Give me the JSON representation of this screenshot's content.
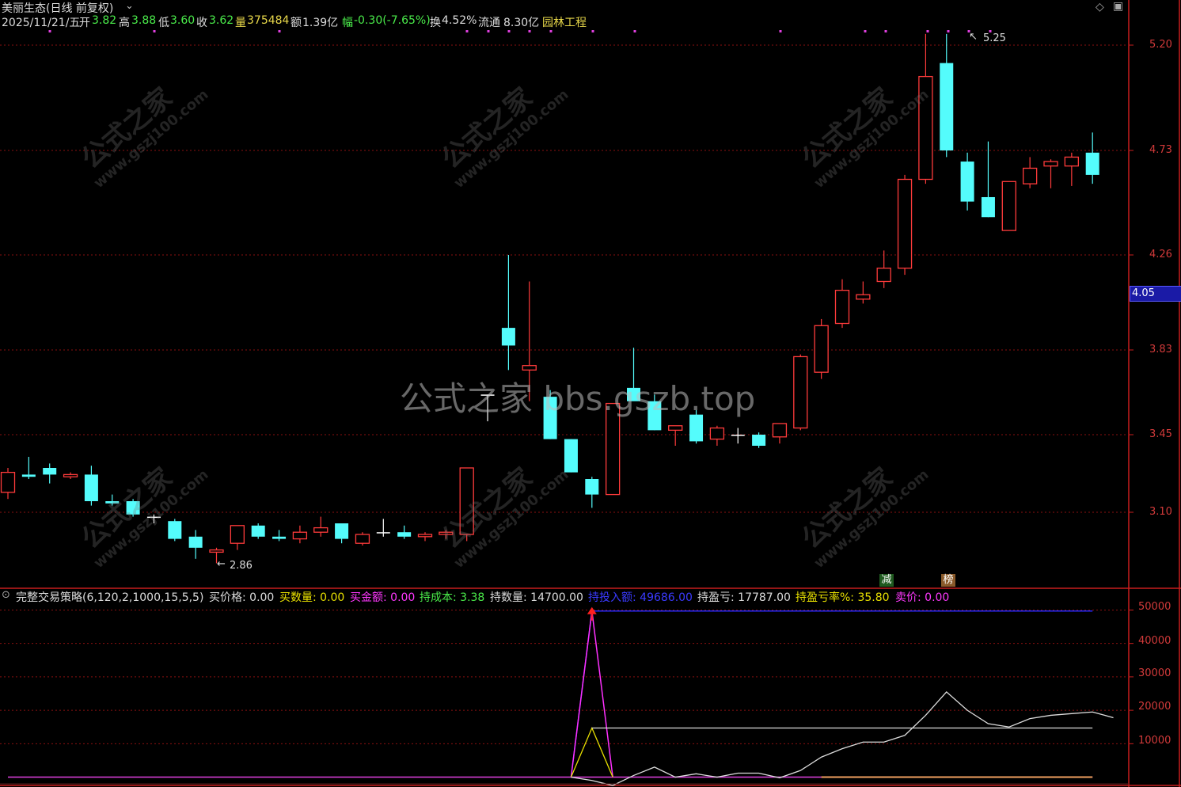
{
  "header": {
    "stock_title": "美丽生态(日线 前复权)",
    "date": "2025/11/21/五",
    "open_label": "开",
    "open": "3.82",
    "high_label": "高",
    "high": "3.88",
    "low_label": "低",
    "low": "3.60",
    "close_label": "收",
    "close": "3.62",
    "volume_label": "量",
    "volume": "375484",
    "amount_label": "额",
    "amount": "1.39亿",
    "change_label": "幅",
    "change": "-0.30(-7.65%)",
    "turnover_label": "换",
    "turnover": "4.52%",
    "float_label": "流通",
    "float": "8.30亿",
    "sector": "园林工程"
  },
  "price_axis": {
    "ticks": [
      "5.20",
      "4.73",
      "4.26",
      "3.83",
      "3.45",
      "3.10"
    ],
    "current_price": "4.05"
  },
  "annotations": {
    "high_mark": "5.25",
    "low_mark": "2.86",
    "badge_reduce": "减",
    "badge_list": "榜"
  },
  "watermark": {
    "main": "公式之家 bbs.gszb.top",
    "small_cn": "公式之家",
    "small_url": "www.gszj100.com"
  },
  "indicator": {
    "name": "完整交易策略(6,120,2,1000,15,5,5)",
    "buy_price": "买价格: 0.00",
    "buy_qty": "买数量: 0.00",
    "buy_amount": "买金额: 0.00",
    "hold_cost": "持成本: 3.38",
    "hold_qty": "持数量: 14700.00",
    "hold_invest": "持投入额: 49686.00",
    "hold_pl": "持盈亏: 17787.00",
    "hold_pl_pct": "持盈亏率%: 35.80",
    "sell_price": "卖价: 0.00",
    "axis_ticks": [
      "50000",
      "40000",
      "30000",
      "20000",
      "10000"
    ]
  },
  "colors": {
    "up": "#ff3b3b",
    "down": "#54fcfc",
    "grid": "#8a1010",
    "axis": "#c81e1e"
  },
  "chart_data": {
    "type": "candlestick",
    "title": "美丽生态(日线 前复权)",
    "ylim": [
      2.75,
      5.35
    ],
    "candles": [
      {
        "o": 3.19,
        "h": 3.3,
        "l": 3.16,
        "c": 3.28
      },
      {
        "o": 3.27,
        "h": 3.35,
        "l": 3.25,
        "c": 3.26
      },
      {
        "o": 3.3,
        "h": 3.32,
        "l": 3.23,
        "c": 3.27
      },
      {
        "o": 3.26,
        "h": 3.28,
        "l": 3.25,
        "c": 3.27
      },
      {
        "o": 3.27,
        "h": 3.31,
        "l": 3.13,
        "c": 3.15
      },
      {
        "o": 3.15,
        "h": 3.18,
        "l": 3.13,
        "c": 3.14
      },
      {
        "o": 3.15,
        "h": 3.16,
        "l": 3.08,
        "c": 3.09
      },
      {
        "o": 3.08,
        "h": 3.09,
        "l": 3.05,
        "c": 3.08
      },
      {
        "o": 3.06,
        "h": 3.07,
        "l": 2.97,
        "c": 2.98
      },
      {
        "o": 2.99,
        "h": 3.02,
        "l": 2.89,
        "c": 2.94
      },
      {
        "o": 2.92,
        "h": 2.94,
        "l": 2.87,
        "c": 2.93
      },
      {
        "o": 2.96,
        "h": 3.04,
        "l": 2.93,
        "c": 3.04
      },
      {
        "o": 3.04,
        "h": 3.05,
        "l": 2.98,
        "c": 2.99
      },
      {
        "o": 2.99,
        "h": 3.02,
        "l": 2.97,
        "c": 2.98
      },
      {
        "o": 2.98,
        "h": 3.04,
        "l": 2.96,
        "c": 3.01
      },
      {
        "o": 3.01,
        "h": 3.08,
        "l": 2.99,
        "c": 3.03
      },
      {
        "o": 3.05,
        "h": 3.05,
        "l": 2.96,
        "c": 2.98
      },
      {
        "o": 2.96,
        "h": 3.01,
        "l": 2.95,
        "c": 3.0
      },
      {
        "o": 3.01,
        "h": 3.07,
        "l": 2.99,
        "c": 3.01
      },
      {
        "o": 3.01,
        "h": 3.04,
        "l": 2.98,
        "c": 2.99
      },
      {
        "o": 2.99,
        "h": 3.01,
        "l": 2.97,
        "c": 3.0
      },
      {
        "o": 3.0,
        "h": 3.02,
        "l": 2.98,
        "c": 3.01
      },
      {
        "o": 3.0,
        "h": 3.3,
        "l": 2.97,
        "c": 3.3
      },
      {
        "o": 3.63,
        "h": 3.63,
        "l": 3.51,
        "c": 3.63
      },
      {
        "o": 3.93,
        "h": 4.26,
        "l": 3.74,
        "c": 3.85
      },
      {
        "o": 3.74,
        "h": 4.14,
        "l": 3.6,
        "c": 3.76
      },
      {
        "o": 3.62,
        "h": 3.65,
        "l": 3.43,
        "c": 3.43
      },
      {
        "o": 3.43,
        "h": 3.43,
        "l": 3.28,
        "c": 3.28
      },
      {
        "o": 3.25,
        "h": 3.26,
        "l": 3.12,
        "c": 3.18
      },
      {
        "o": 3.18,
        "h": 3.59,
        "l": 3.18,
        "c": 3.59
      },
      {
        "o": 3.66,
        "h": 3.84,
        "l": 3.61,
        "c": 3.6
      },
      {
        "o": 3.6,
        "h": 3.63,
        "l": 3.47,
        "c": 3.47
      },
      {
        "o": 3.47,
        "h": 3.49,
        "l": 3.4,
        "c": 3.49
      },
      {
        "o": 3.54,
        "h": 3.56,
        "l": 3.41,
        "c": 3.42
      },
      {
        "o": 3.43,
        "h": 3.49,
        "l": 3.4,
        "c": 3.48
      },
      {
        "o": 3.45,
        "h": 3.48,
        "l": 3.41,
        "c": 3.45
      },
      {
        "o": 3.45,
        "h": 3.46,
        "l": 3.39,
        "c": 3.4
      },
      {
        "o": 3.44,
        "h": 3.5,
        "l": 3.41,
        "c": 3.5
      },
      {
        "o": 3.48,
        "h": 3.81,
        "l": 3.47,
        "c": 3.8
      },
      {
        "o": 3.73,
        "h": 3.97,
        "l": 3.7,
        "c": 3.94
      },
      {
        "o": 3.95,
        "h": 4.15,
        "l": 3.93,
        "c": 4.1
      },
      {
        "o": 4.06,
        "h": 4.14,
        "l": 4.04,
        "c": 4.08
      },
      {
        "o": 4.14,
        "h": 4.28,
        "l": 4.11,
        "c": 4.2
      },
      {
        "o": 4.2,
        "h": 4.62,
        "l": 4.17,
        "c": 4.6
      },
      {
        "o": 4.6,
        "h": 5.25,
        "l": 4.58,
        "c": 5.06
      },
      {
        "o": 5.12,
        "h": 5.25,
        "l": 4.7,
        "c": 4.73
      },
      {
        "o": 4.68,
        "h": 4.72,
        "l": 4.46,
        "c": 4.5
      },
      {
        "o": 4.52,
        "h": 4.77,
        "l": 4.43,
        "c": 4.43
      },
      {
        "o": 4.37,
        "h": 4.58,
        "l": 4.37,
        "c": 4.59
      },
      {
        "o": 4.58,
        "h": 4.7,
        "l": 4.56,
        "c": 4.65
      },
      {
        "o": 4.66,
        "h": 4.69,
        "l": 4.56,
        "c": 4.68
      },
      {
        "o": 4.66,
        "h": 4.72,
        "l": 4.57,
        "c": 4.7
      },
      {
        "o": 4.72,
        "h": 4.81,
        "l": 4.58,
        "c": 4.62
      }
    ],
    "indicator_series": {
      "ylim": [
        -2000,
        52000
      ],
      "invest": [
        0,
        0,
        0,
        0,
        0,
        0,
        0,
        0,
        0,
        0,
        0,
        0,
        0,
        0,
        0,
        0,
        0,
        0,
        0,
        0,
        0,
        0,
        0,
        0,
        0,
        0,
        0,
        0,
        0,
        49686,
        49686,
        49686,
        49686,
        49686,
        49686,
        49686,
        49686,
        49686,
        49686,
        49686,
        49686,
        49686,
        49686,
        49686,
        49686,
        49686,
        49686,
        49686,
        49686,
        49686,
        49686,
        49686,
        49686
      ],
      "pl": [
        0,
        0,
        0,
        0,
        0,
        0,
        0,
        0,
        0,
        0,
        0,
        0,
        0,
        0,
        0,
        0,
        0,
        0,
        0,
        0,
        0,
        0,
        0,
        0,
        0,
        0,
        0,
        0,
        -1000,
        -2500,
        500,
        3000,
        0,
        1000,
        0,
        1200,
        1200,
        -200,
        2000,
        6000,
        8500,
        10500,
        10500,
        12500,
        18500,
        25500,
        20000,
        16000,
        15000,
        17500,
        18500,
        19000,
        19500,
        17787
      ],
      "cost_line": [
        0,
        0,
        0,
        0,
        0,
        0,
        0,
        0,
        0,
        0,
        0,
        0,
        0,
        0,
        0,
        0,
        0,
        0,
        0,
        0,
        0,
        0,
        0,
        0,
        0,
        0,
        0,
        0,
        14700,
        14700,
        14700,
        14700,
        14700,
        14700,
        14700,
        14700,
        14700,
        14700,
        14700,
        14700,
        14700,
        14700,
        14700,
        14700,
        14700,
        14700,
        14700,
        14700,
        14700,
        14700,
        14700,
        14700,
        14700
      ]
    }
  }
}
